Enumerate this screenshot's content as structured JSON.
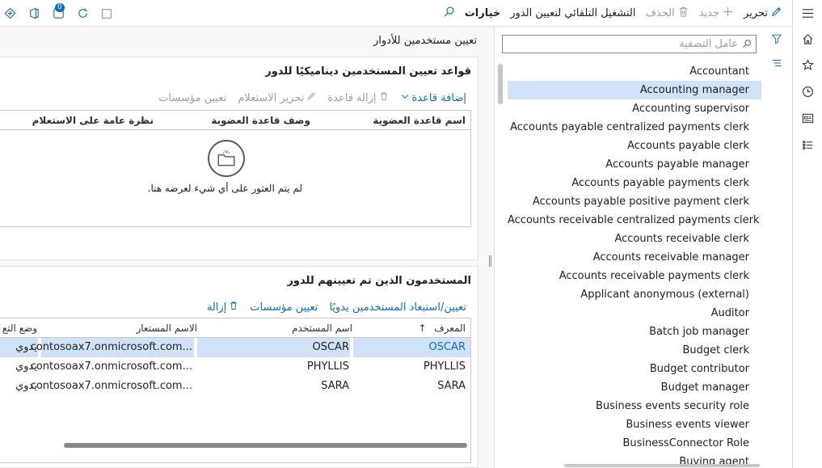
{
  "toolbar": {
    "edit_label": "تحرير",
    "new_label": "جديد",
    "delete_label": "الحذف",
    "auto_assign_label": "التشغيل التلقائي لتعيين الدور",
    "options_label": "خيارات",
    "notification_count": "0"
  },
  "list": {
    "filter_placeholder": "عامل التصفية",
    "selected_index": 1,
    "items": [
      "Accountant",
      "Accounting manager",
      "Accounting supervisor",
      "Accounts payable centralized payments clerk",
      "Accounts payable clerk",
      "Accounts payable manager",
      "Accounts payable payments clerk",
      "Accounts payable positive payment clerk",
      "Accounts receivable centralized payments clerk",
      "Accounts receivable clerk",
      "Accounts receivable manager",
      "Accounts receivable payments clerk",
      "Applicant anonymous (external)",
      "Auditor",
      "Batch job manager",
      "Budget clerk",
      "Budget contributor",
      "Budget manager",
      "Business events security role",
      "Business events viewer",
      "BusinessConnector Role",
      "Buying agent"
    ]
  },
  "main": {
    "page_title": "تعيين مستخدمين للأدوار",
    "rules": {
      "title": "قواعد تعيين المستخدمين ديناميكيًا للدور",
      "add_rule": "إضافة قاعدة",
      "remove_rule": "إزالة قاعدة",
      "edit_query": "تحرير الاستعلام",
      "assign_orgs": "تعيين مؤسسات",
      "col_name": "اسم قاعدة العضوية",
      "col_desc": "وصف قاعدة العضوية",
      "col_query": "نظرة عامة على الاستعلام",
      "empty_text": "لم يتم العثور على أي شيء لعرضه هنا."
    },
    "users": {
      "title": "المستخدمون الذين تم تعيينهم للدور",
      "manual_assign": "تعيين/استبعاد المستخدمين يدويًا",
      "assign_orgs": "تعيين مؤسسات",
      "remove": "إزالة",
      "col_id": "المعرف",
      "col_name": "اسم المستخدم",
      "col_alias": "الاسم المستعار",
      "col_mode": "وضع التع",
      "rows": [
        {
          "id": "OSCAR",
          "name": "OSCAR",
          "alias": "...contosoax7.onmicrosoft.com",
          "mode": "يدوي"
        },
        {
          "id": "PHYLLIS",
          "name": "PHYLLIS",
          "alias": "...contosoax7.onmicrosoft.com",
          "mode": "يدوي"
        },
        {
          "id": "SARA",
          "name": "SARA",
          "alias": "...contosoax7.onmicrosoft.com",
          "mode": "يدوي"
        }
      ]
    }
  },
  "colors": {
    "accent": "#0f6cbd",
    "selection": "#cfe2f8"
  }
}
